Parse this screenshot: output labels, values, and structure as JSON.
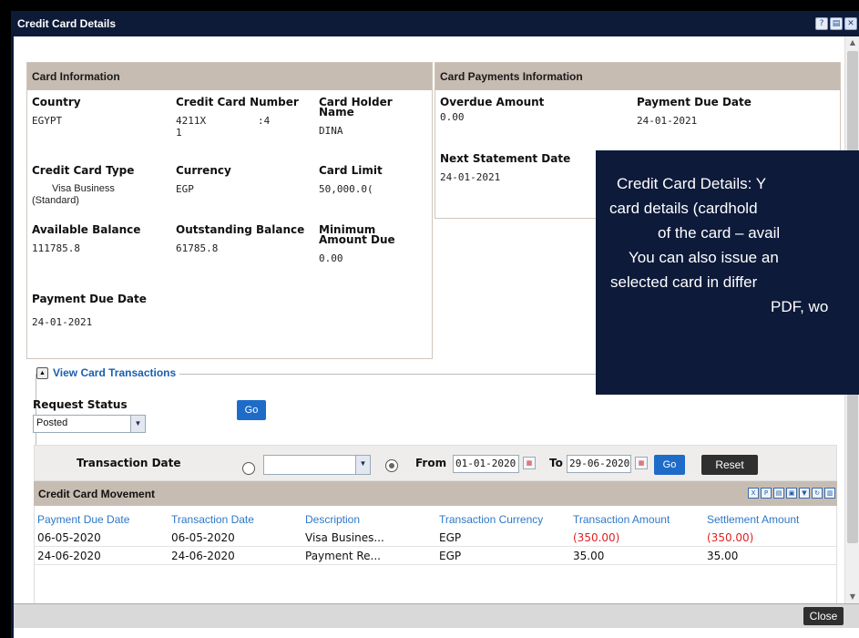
{
  "window": {
    "title": "Credit Card Details",
    "close_label": "Close"
  },
  "titlebar_icons": [
    "help-icon",
    "print-icon",
    "close-icon"
  ],
  "card_info": {
    "header": "Card Information",
    "country_label": "Country",
    "country": "EGYPT",
    "number_label": "Credit Card Number",
    "number_line1": "4211X",
    "number_mid": ":4",
    "number_line2": "1",
    "holder_label": "Card Holder Name",
    "holder": "DINA",
    "type_label": "Credit Card Type",
    "type": "Visa Business (Standard)",
    "currency_label": "Currency",
    "currency": "EGP",
    "limit_label": "Card Limit",
    "limit": "50,000.0(",
    "available_label": "Available Balance",
    "available": "111785.8",
    "outstanding_label": "Outstanding Balance",
    "outstanding": "61785.8",
    "min_due_label": "Minimum Amount Due",
    "min_due": "0.00",
    "payment_due_label": "Payment Due Date",
    "payment_due": "24-01-2021"
  },
  "payments_info": {
    "header": "Card Payments Information",
    "overdue_label": "Overdue Amount",
    "overdue": "0.00",
    "due_date_label": "Payment Due Date",
    "due_date": "24-01-2021",
    "statement_label": "Next Statement Date",
    "statement": "24-01-2021"
  },
  "transactions": {
    "legend": "View Card Transactions",
    "request_status_label": "Request Status",
    "request_status": "Posted",
    "go_label": "Go",
    "transaction_date_label": "Transaction Date",
    "period_select": "",
    "from_label": "From",
    "from_date": "01-01-2020",
    "to_label": "To",
    "to_date": "29-06-2020",
    "go2_label": "Go",
    "reset_label": "Reset",
    "grid_title": "Credit Card Movement",
    "grid_tool_icons": [
      "export-excel-icon",
      "export-pdf-icon",
      "print-icon",
      "save-icon",
      "filter-icon",
      "refresh-icon",
      "print-preview-icon"
    ],
    "columns": [
      "Payment Due Date",
      "Transaction Date",
      "Description",
      "Transaction Currency",
      "Transaction Amount",
      "Settlement Amount"
    ],
    "rows": [
      [
        "06-05-2020",
        "06-05-2020",
        "Visa Busines...",
        "EGP",
        "(350.00)",
        "(350.00)"
      ],
      [
        "24-06-2020",
        "24-06-2020",
        "Payment Re...",
        "EGP",
        "35.00",
        "35.00"
      ]
    ]
  },
  "overlay": {
    "lines": [
      "Credit Card Details: Y",
      "card details (cardhold",
      "of the card – avail",
      "You can also issue an",
      "selected card in differ",
      "PDF, wo"
    ]
  },
  "colors": {
    "titlebar": "#0d1a38",
    "panel_header": "#c7bcb2",
    "link_blue": "#2e78c8",
    "negative": "#e02020",
    "button_blue": "#1e6cc8"
  }
}
